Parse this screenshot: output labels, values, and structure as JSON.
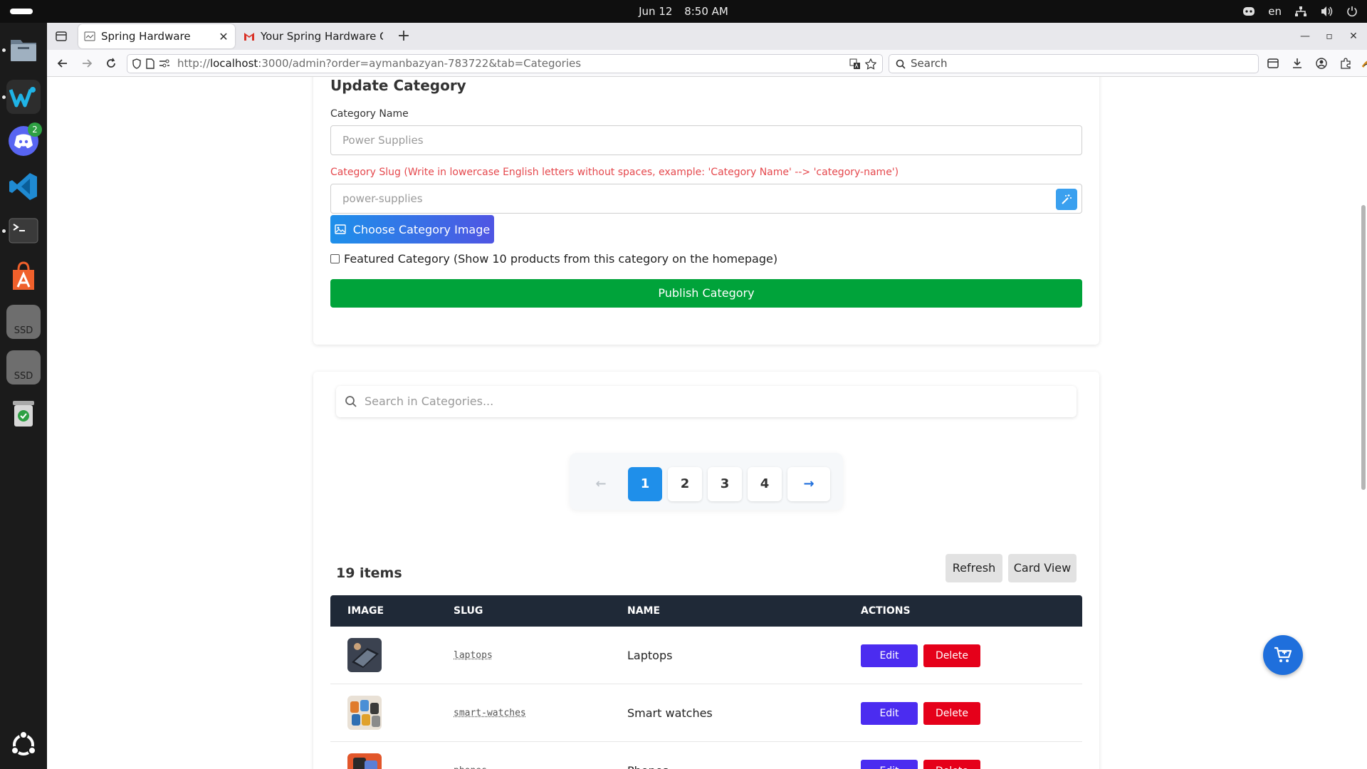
{
  "system": {
    "date": "Jun 12",
    "time": "8:50 AM",
    "language": "en"
  },
  "dock": {
    "discord_badge": "2",
    "ssd_label_1": "SSD",
    "ssd_label_2": "SSD"
  },
  "browser": {
    "tabs": [
      {
        "title": "Spring Hardware",
        "active": true
      },
      {
        "title": "Your Spring Hardware Order",
        "active": false
      }
    ],
    "url_prefix": "http://",
    "url_host": "localhost",
    "url_rest": ":3000/admin?order=aymanbazyan-783722&tab=Categories",
    "search_placeholder": "Search"
  },
  "form": {
    "title": "Update Category",
    "name_label": "Category Name",
    "name_value": "Power Supplies",
    "slug_label": "Category Slug (Write in lowercase English letters without spaces, example: 'Category Name' --> 'category-name')",
    "slug_value": "power-supplies",
    "choose_image_label": "Choose Category Image",
    "featured_label": "Featured Category (Show 10 products from this category on the homepage)",
    "featured_checked": false,
    "publish_label": "Publish Category"
  },
  "list": {
    "search_placeholder": "Search in Categories...",
    "pagination": {
      "prev": "←",
      "pages": [
        "1",
        "2",
        "3",
        "4"
      ],
      "current": "1",
      "next": "→"
    },
    "items_count": "19 items",
    "refresh_label": "Refresh",
    "card_view_label": "Card View",
    "columns": [
      "IMAGE",
      "SLUG",
      "NAME",
      "ACTIONS"
    ],
    "rows": [
      {
        "slug": "laptops",
        "name": "Laptops",
        "edit": "Edit",
        "delete": "Delete"
      },
      {
        "slug": "smart-watches",
        "name": "Smart watches",
        "edit": "Edit",
        "delete": "Delete"
      },
      {
        "slug": "phones",
        "name": "Phones",
        "edit": "Edit",
        "delete": "Delete"
      }
    ]
  },
  "colors": {
    "primary_blue": "#1f8fea",
    "edit_purple": "#4b2cf0",
    "delete_red": "#e5001a",
    "publish_green": "#00a33a",
    "table_header": "#1f2937",
    "warning_text": "#e5484d"
  }
}
